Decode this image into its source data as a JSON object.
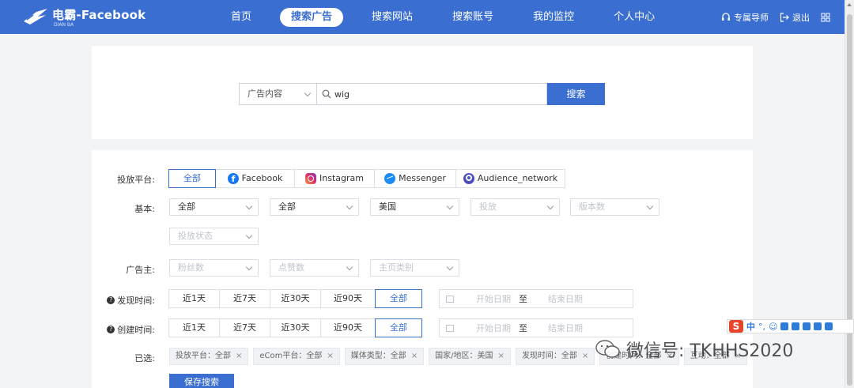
{
  "header": {
    "logo_text": "电霸-Facebook",
    "logo_sub": "DIAN BA",
    "nav": [
      "首页",
      "搜索广告",
      "搜索网站",
      "搜索账号",
      "我的监控",
      "个人中心"
    ],
    "active_nav": "搜索广告",
    "tools": {
      "guide": "专属导师",
      "logout": "退出"
    }
  },
  "search": {
    "scope": "广告内容",
    "query": "wig",
    "button": "搜索"
  },
  "filters": {
    "platform_label": "投放平台:",
    "platforms": [
      {
        "label": "全部",
        "icon": "all"
      },
      {
        "label": "Facebook",
        "icon": "facebook-icon"
      },
      {
        "label": "Instagram",
        "icon": "instagram-icon"
      },
      {
        "label": "Messenger",
        "icon": "messenger-icon"
      },
      {
        "label": "Audience_network",
        "icon": "audience-network-icon"
      }
    ],
    "basic_label": "基本:",
    "basic": [
      "全部",
      "全部",
      "美国",
      "投放",
      "版本数",
      "投放状态"
    ],
    "advertiser_label": "广告主:",
    "advertiser": [
      "粉丝数",
      "点赞数",
      "主页类别"
    ],
    "found_label": "发现时间:",
    "created_label": "创建时间:",
    "time_options": [
      "近1天",
      "近7天",
      "近30天",
      "近90天",
      "全部"
    ],
    "date_start": "开始日期",
    "date_sep": "至",
    "date_end": "结束日期",
    "selected_label": "已选:",
    "selected_tags": [
      "投放平台：全部",
      "eCom平台：全部",
      "媒体类型：全部",
      "国家/地区：美国",
      "发现时间：全部",
      "创建时间：全部",
      "互动：全部"
    ],
    "save_button": "保存搜索"
  },
  "ime": {
    "logo": "S",
    "items": [
      "中",
      "°,",
      "☺",
      "🎤",
      "⌨",
      "☴",
      "👕",
      "▦",
      "⁞⁞"
    ]
  },
  "watermark": "微信号: TKHHS2020",
  "colors": {
    "primary": "#3a6fd1",
    "page_bg": "#f3f4f6"
  }
}
